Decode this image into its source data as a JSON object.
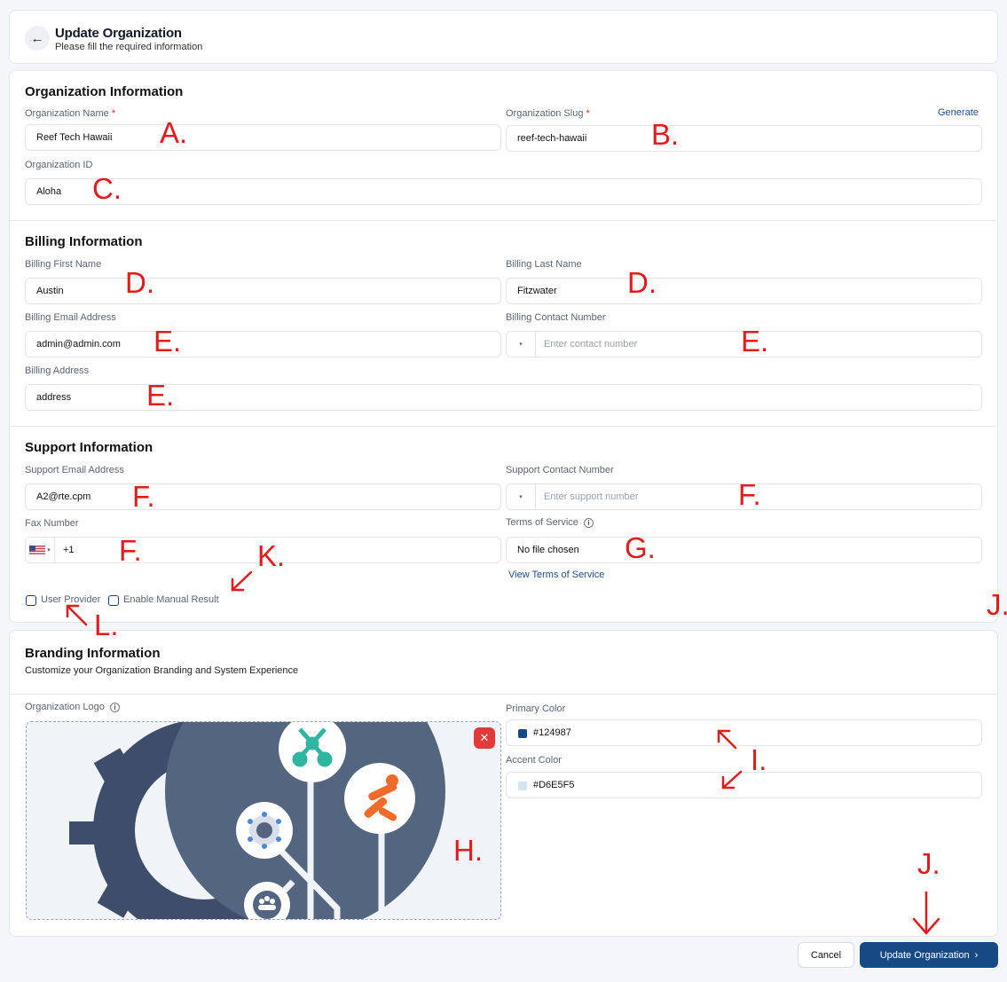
{
  "header": {
    "title": "Update Organization",
    "subtitle": "Please fill the required information"
  },
  "org": {
    "section_title": "Organization Information",
    "name_label": "Organization Name",
    "name_value": "Reef Tech Hawaii",
    "slug_label": "Organization Slug",
    "slug_value": "reef-tech-hawaii",
    "generate_label": "Generate",
    "id_label": "Organization ID",
    "id_value": "Aloha",
    "required_mark": "*"
  },
  "billing": {
    "section_title": "Billing Information",
    "first_name_label": "Billing First Name",
    "first_name_value": "Austin",
    "last_name_label": "Billing Last Name",
    "last_name_value": "Fitzwater",
    "email_label": "Billing Email Address",
    "email_value": "admin@admin.com",
    "contact_label": "Billing Contact Number",
    "contact_placeholder": "Enter contact number",
    "address_label": "Billing Address",
    "address_value": "address"
  },
  "support": {
    "section_title": "Support Information",
    "email_label": "Support Email Address",
    "email_value": "A2@rte.cpm",
    "contact_label": "Support Contact Number",
    "contact_placeholder": "Enter support number",
    "fax_label": "Fax Number",
    "fax_value": "+1",
    "tos_label": "Terms of Service",
    "tos_value": "No file chosen",
    "tos_link": "View Terms of Service",
    "user_provider_label": "User Provider",
    "manual_result_label": "Enable Manual Result"
  },
  "branding": {
    "section_title": "Branding Information",
    "subtitle": "Customize your Organization Branding and System Experience",
    "logo_label": "Organization Logo",
    "primary_label": "Primary Color",
    "primary_value": "#124987",
    "accent_label": "Accent Color",
    "accent_value": "#D6E5F5"
  },
  "actions": {
    "cancel_label": "Cancel",
    "update_label": "Update Organization"
  },
  "annotations": {
    "a": "A.",
    "b": "B.",
    "c": "C.",
    "d": "D.",
    "e": "E.",
    "f": "F.",
    "g": "G.",
    "h": "H.",
    "i": "I.",
    "j": "J.",
    "k": "K.",
    "l": "L."
  },
  "colors": {
    "brand_primary": "#124987",
    "brand_accent": "#D6E5F5",
    "annotation_red": "#e21b1b"
  }
}
